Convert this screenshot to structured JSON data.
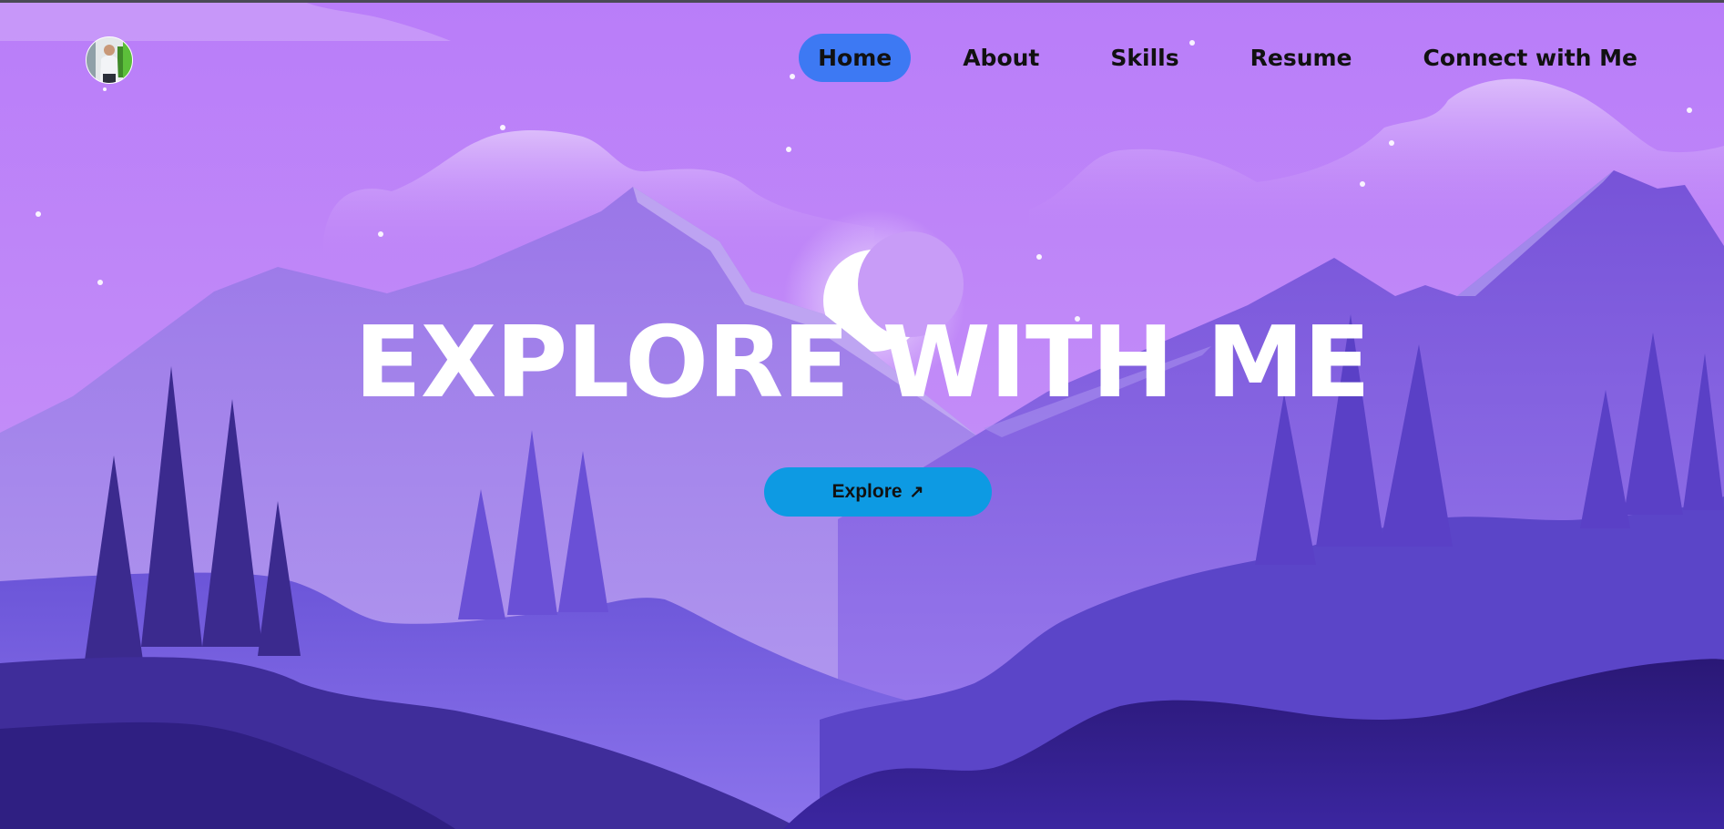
{
  "nav": {
    "items": [
      {
        "label": "Home",
        "active": true
      },
      {
        "label": "About",
        "active": false
      },
      {
        "label": "Skills",
        "active": false
      },
      {
        "label": "Resume",
        "active": false
      },
      {
        "label": "Connect with Me",
        "active": false
      }
    ]
  },
  "hero": {
    "title": "EXPLORE WITH ME",
    "button_label": "Explore",
    "button_icon": "↗"
  },
  "colors": {
    "active_nav": "#3d79f3",
    "button": "#0d9ae3",
    "sky": "#b47cf7",
    "title": "#ffffff"
  }
}
